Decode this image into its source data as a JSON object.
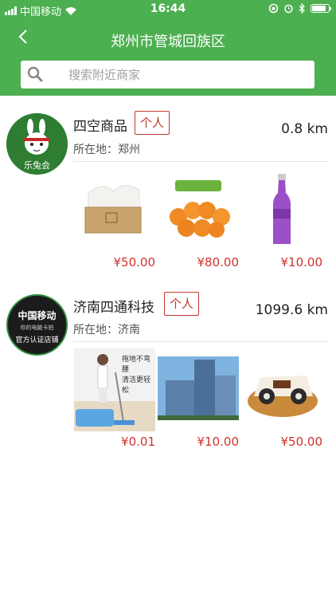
{
  "status": {
    "carrier": "中国移动",
    "time": "16:44"
  },
  "header": {
    "title": "郑州市管城回族区",
    "back_icon": "chevron-left-icon"
  },
  "search": {
    "placeholder": "搜索附近商家"
  },
  "shops": [
    {
      "name": "四空商品",
      "tag": "个人",
      "distance": "0.8 km",
      "location": "所在地：郑州",
      "logo_text": "乐兔会",
      "products": [
        {
          "image": "tissue-box",
          "price": "¥50.00"
        },
        {
          "image": "oranges",
          "price": "¥80.00"
        },
        {
          "image": "rio-bottle",
          "price": "¥10.00"
        }
      ]
    },
    {
      "name": "济南四通科技",
      "tag": "个人",
      "distance": "1099.6 km",
      "location": "所在地：济南",
      "logo_text": {
        "line1": "中国移动",
        "line2": "你的电脑卡拍",
        "line3": "官方认证店铺"
      },
      "products": [
        {
          "image": "mop-cleaning",
          "overlay": "拖地不弯腰\n清洁更轻松",
          "price": "¥0.01"
        },
        {
          "image": "building",
          "price": "¥10.00"
        },
        {
          "image": "cake",
          "price": "¥50.00"
        }
      ]
    }
  ],
  "colors": {
    "brand_green": "#4caf50",
    "price_red": "#d0312d",
    "tag_red": "#c0392b"
  }
}
